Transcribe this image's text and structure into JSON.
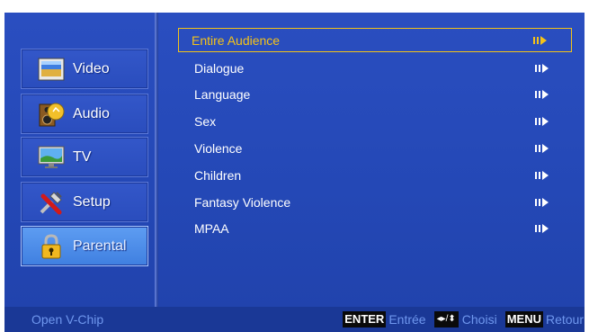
{
  "sidebar": {
    "items": [
      {
        "label": "Video",
        "icon": "video-icon",
        "active": false
      },
      {
        "label": "Audio",
        "icon": "audio-icon",
        "active": false
      },
      {
        "label": "TV",
        "icon": "tv-icon",
        "active": false
      },
      {
        "label": "Setup",
        "icon": "setup-icon",
        "active": false
      },
      {
        "label": "Parental",
        "icon": "parental-lock-icon",
        "active": true
      }
    ]
  },
  "menu": {
    "items": [
      {
        "label": "Entire Audience",
        "selected": true
      },
      {
        "label": "Dialogue",
        "selected": false
      },
      {
        "label": "Language",
        "selected": false
      },
      {
        "label": "Sex",
        "selected": false
      },
      {
        "label": "Violence",
        "selected": false
      },
      {
        "label": "Children",
        "selected": false
      },
      {
        "label": "Fantasy Violence",
        "selected": false
      },
      {
        "label": "MPAA",
        "selected": false
      }
    ]
  },
  "footer": {
    "hint": "Open V-Chip",
    "enter_key": "ENTER",
    "enter_desc": "Entrée",
    "arrows_key": "◂▸/⬍",
    "arrows_desc": "Choisi",
    "menu_key": "MENU",
    "menu_desc": "Retour"
  },
  "colors": {
    "panel": "#2448b6",
    "selection": "#f5c318",
    "footer_text": "#6f97ee"
  }
}
